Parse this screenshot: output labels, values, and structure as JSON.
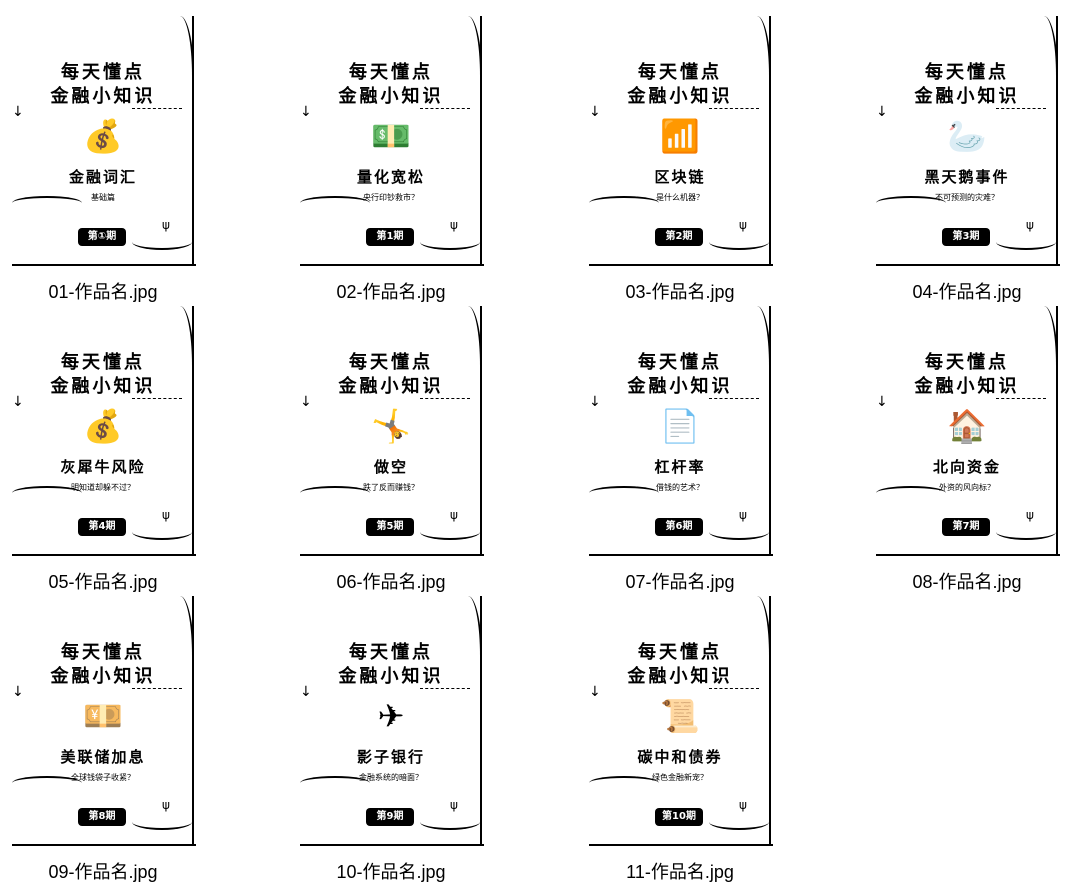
{
  "cover": {
    "line1": "每天懂点",
    "line2": "金融小知识"
  },
  "items": [
    {
      "file": "01-作品名.jpg",
      "topic": "金融词汇",
      "sub": "基础篇",
      "issue": "第①期",
      "icon": "money-bag-icon",
      "glyph": "💰"
    },
    {
      "file": "02-作品名.jpg",
      "topic": "量化宽松",
      "sub": "央行印钞救市？",
      "issue": "第1期",
      "icon": "banknote-icon",
      "glyph": "💵"
    },
    {
      "file": "03-作品名.jpg",
      "topic": "区块链",
      "sub": "是什么机器？",
      "issue": "第2期",
      "icon": "growth-chart-icon",
      "glyph": "📶"
    },
    {
      "file": "04-作品名.jpg",
      "topic": "黑天鹅事件",
      "sub": "不可预测的灾难？",
      "issue": "第3期",
      "icon": "black-swan-icon",
      "glyph": "🦢"
    },
    {
      "file": "05-作品名.jpg",
      "topic": "灰犀牛风险",
      "sub": "明知道却躲不过？",
      "issue": "第4期",
      "icon": "money-bag-icon",
      "glyph": "💰"
    },
    {
      "file": "06-作品名.jpg",
      "topic": "做空",
      "sub": "跌了反而赚钱？",
      "issue": "第5期",
      "icon": "falling-person-icon",
      "glyph": "🤸"
    },
    {
      "file": "07-作品名.jpg",
      "topic": "杠杆率",
      "sub": "借钱的艺术？",
      "issue": "第6期",
      "icon": "document-icon",
      "glyph": "📄"
    },
    {
      "file": "08-作品名.jpg",
      "topic": "北向资金",
      "sub": "外资的风向标？",
      "issue": "第7期",
      "icon": "house-icon",
      "glyph": "🏠"
    },
    {
      "file": "09-作品名.jpg",
      "topic": "美联储加息",
      "sub": "全球钱袋子收紧？",
      "issue": "第8期",
      "icon": "cash-stack-icon",
      "glyph": "💴"
    },
    {
      "file": "10-作品名.jpg",
      "topic": "影子银行",
      "sub": "金融系统的暗面？",
      "issue": "第9期",
      "icon": "plane-down-icon",
      "glyph": "✈"
    },
    {
      "file": "11-作品名.jpg",
      "topic": "碳中和债券",
      "sub": "绿色金融新宠？",
      "issue": "第10期",
      "icon": "scroll-icon",
      "glyph": "📜"
    }
  ]
}
